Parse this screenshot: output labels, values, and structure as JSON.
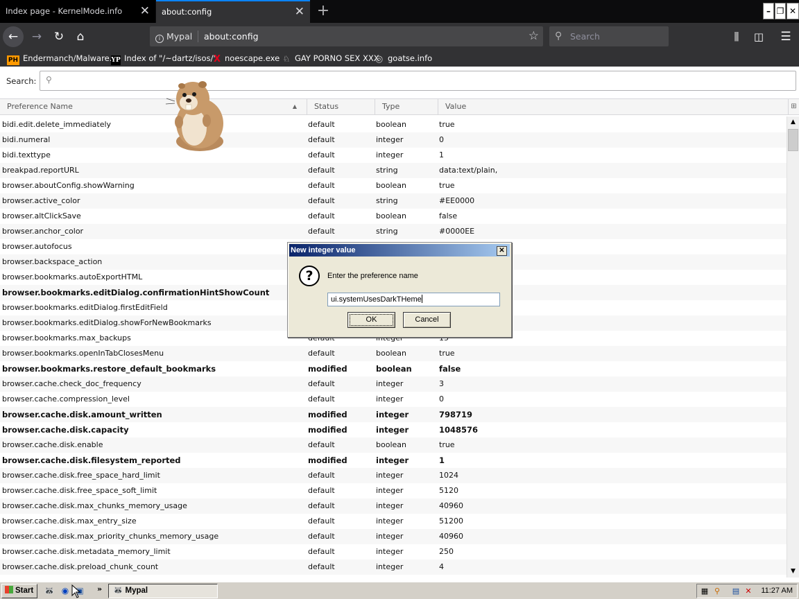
{
  "tabs": [
    {
      "title": "Index page - KernelMode.info",
      "close": "✕"
    },
    {
      "title": "about:config",
      "close": "✕"
    }
  ],
  "new_tab": "+",
  "window_controls": {
    "minimize": "–",
    "maximize": "❐",
    "close": "✕"
  },
  "navbar": {
    "back": "←",
    "forward": "→",
    "reload": "↻",
    "home": "⌂",
    "identity_label": "Mypal",
    "url": "about:config",
    "bookmark_star": "☆",
    "search_placeholder": "Search",
    "library": "⫼",
    "sidebar": "◫",
    "menu": "☰"
  },
  "bookmarks": [
    {
      "favicon": "PH",
      "label": "Endermanch/Malware..."
    },
    {
      "favicon": "YP",
      "label": "Index of \"/~dartz/isos/\""
    },
    {
      "favicon": "X",
      "label": "noescape.exe"
    },
    {
      "favicon": "♘",
      "label": "GAY PORNO SEX XXX"
    },
    {
      "favicon": "◎",
      "label": "goatse.info"
    }
  ],
  "config_search": {
    "label": "Search:",
    "value": ""
  },
  "columns": {
    "name": "Preference Name",
    "status": "Status",
    "type": "Type",
    "value": "Value",
    "sort_indicator": "▲"
  },
  "rows": [
    {
      "name": "bidi.edit.delete_immediately",
      "status": "default",
      "type": "boolean",
      "value": "true"
    },
    {
      "name": "bidi.numeral",
      "status": "default",
      "type": "integer",
      "value": "0"
    },
    {
      "name": "bidi.texttype",
      "status": "default",
      "type": "integer",
      "value": "1"
    },
    {
      "name": "breakpad.reportURL",
      "status": "default",
      "type": "string",
      "value": "data:text/plain,"
    },
    {
      "name": "browser.aboutConfig.showWarning",
      "status": "default",
      "type": "boolean",
      "value": "true"
    },
    {
      "name": "browser.active_color",
      "status": "default",
      "type": "string",
      "value": "#EE0000"
    },
    {
      "name": "browser.altClickSave",
      "status": "default",
      "type": "boolean",
      "value": "false"
    },
    {
      "name": "browser.anchor_color",
      "status": "default",
      "type": "string",
      "value": "#0000EE"
    },
    {
      "name": "browser.autofocus",
      "status": "",
      "type": "",
      "value": ""
    },
    {
      "name": "browser.backspace_action",
      "status": "",
      "type": "",
      "value": ""
    },
    {
      "name": "browser.bookmarks.autoExportHTML",
      "status": "",
      "type": "",
      "value": ""
    },
    {
      "name": "browser.bookmarks.editDialog.confirmationHintShowCount",
      "status": "",
      "type": "",
      "value": "",
      "modified": true
    },
    {
      "name": "browser.bookmarks.editDialog.firstEditField",
      "status": "",
      "type": "",
      "value": ""
    },
    {
      "name": "browser.bookmarks.editDialog.showForNewBookmarks",
      "status": "",
      "type": "",
      "value": ""
    },
    {
      "name": "browser.bookmarks.max_backups",
      "status": "default",
      "type": "integer",
      "value": "15"
    },
    {
      "name": "browser.bookmarks.openInTabClosesMenu",
      "status": "default",
      "type": "boolean",
      "value": "true"
    },
    {
      "name": "browser.bookmarks.restore_default_bookmarks",
      "status": "modified",
      "type": "boolean",
      "value": "false",
      "modified": true
    },
    {
      "name": "browser.cache.check_doc_frequency",
      "status": "default",
      "type": "integer",
      "value": "3"
    },
    {
      "name": "browser.cache.compression_level",
      "status": "default",
      "type": "integer",
      "value": "0"
    },
    {
      "name": "browser.cache.disk.amount_written",
      "status": "modified",
      "type": "integer",
      "value": "798719",
      "modified": true
    },
    {
      "name": "browser.cache.disk.capacity",
      "status": "modified",
      "type": "integer",
      "value": "1048576",
      "modified": true
    },
    {
      "name": "browser.cache.disk.enable",
      "status": "default",
      "type": "boolean",
      "value": "true"
    },
    {
      "name": "browser.cache.disk.filesystem_reported",
      "status": "modified",
      "type": "integer",
      "value": "1",
      "modified": true
    },
    {
      "name": "browser.cache.disk.free_space_hard_limit",
      "status": "default",
      "type": "integer",
      "value": "1024"
    },
    {
      "name": "browser.cache.disk.free_space_soft_limit",
      "status": "default",
      "type": "integer",
      "value": "5120"
    },
    {
      "name": "browser.cache.disk.max_chunks_memory_usage",
      "status": "default",
      "type": "integer",
      "value": "40960"
    },
    {
      "name": "browser.cache.disk.max_entry_size",
      "status": "default",
      "type": "integer",
      "value": "51200"
    },
    {
      "name": "browser.cache.disk.max_priority_chunks_memory_usage",
      "status": "default",
      "type": "integer",
      "value": "40960"
    },
    {
      "name": "browser.cache.disk.metadata_memory_limit",
      "status": "default",
      "type": "integer",
      "value": "250"
    },
    {
      "name": "browser.cache.disk.preload_chunk_count",
      "status": "default",
      "type": "integer",
      "value": "4"
    }
  ],
  "dialog": {
    "title": "New integer value",
    "close": "✕",
    "icon": "?",
    "prompt": "Enter the preference name",
    "input_value": "ui.systemUsesDarkTHeme",
    "ok_label": "OK",
    "cancel_label": "Cancel"
  },
  "taskbar": {
    "start_label": "Start",
    "more": "»",
    "task_label": "Mypal",
    "clock": "11:27 AM"
  },
  "colors": {
    "tab_bar": "#0c0c0d",
    "toolbar": "#323234",
    "active_tab_line": "#0a84ff",
    "dialog_title": "#0a246a"
  }
}
